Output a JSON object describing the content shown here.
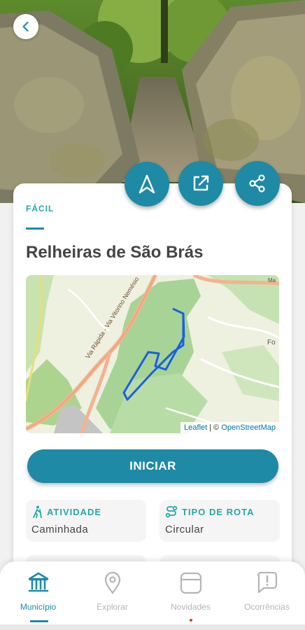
{
  "hero": {
    "image": "stone-trail-photo"
  },
  "header": {
    "back_icon": "chevron-left-icon"
  },
  "actions": {
    "navigate_icon": "navigation-arrow-icon",
    "open_icon": "external-link-icon",
    "share_icon": "share-icon"
  },
  "route": {
    "difficulty": "FÁCIL",
    "title": "Relheiras de São Brás"
  },
  "map": {
    "attribution_leaflet": "Leaflet",
    "attribution_sep": " | © ",
    "attribution_osm": "OpenStreetMap",
    "road_label": "Via Rápida - Via Vitorino Nemésio",
    "place_label_1": "Fo",
    "place_label_2": "Ma"
  },
  "start_button": {
    "label": "INICIAR"
  },
  "info": {
    "activity": {
      "label": "ATIVIDADE",
      "value": "Caminhada",
      "icon": "hiking-icon"
    },
    "route_type": {
      "label": "TIPO DE ROTA",
      "value": "Circular",
      "icon": "route-icon"
    }
  },
  "nav": {
    "items": [
      {
        "label": "Município",
        "icon": "bank-icon"
      },
      {
        "label": "Explorar",
        "icon": "location-pin-icon"
      },
      {
        "label": "Novidades",
        "icon": "news-icon"
      },
      {
        "label": "Ocorrências",
        "icon": "alert-message-icon"
      }
    ]
  },
  "colors": {
    "accent": "#1e8aa5",
    "teal_text": "#25a7a7",
    "route_line": "#1a5fe0"
  }
}
